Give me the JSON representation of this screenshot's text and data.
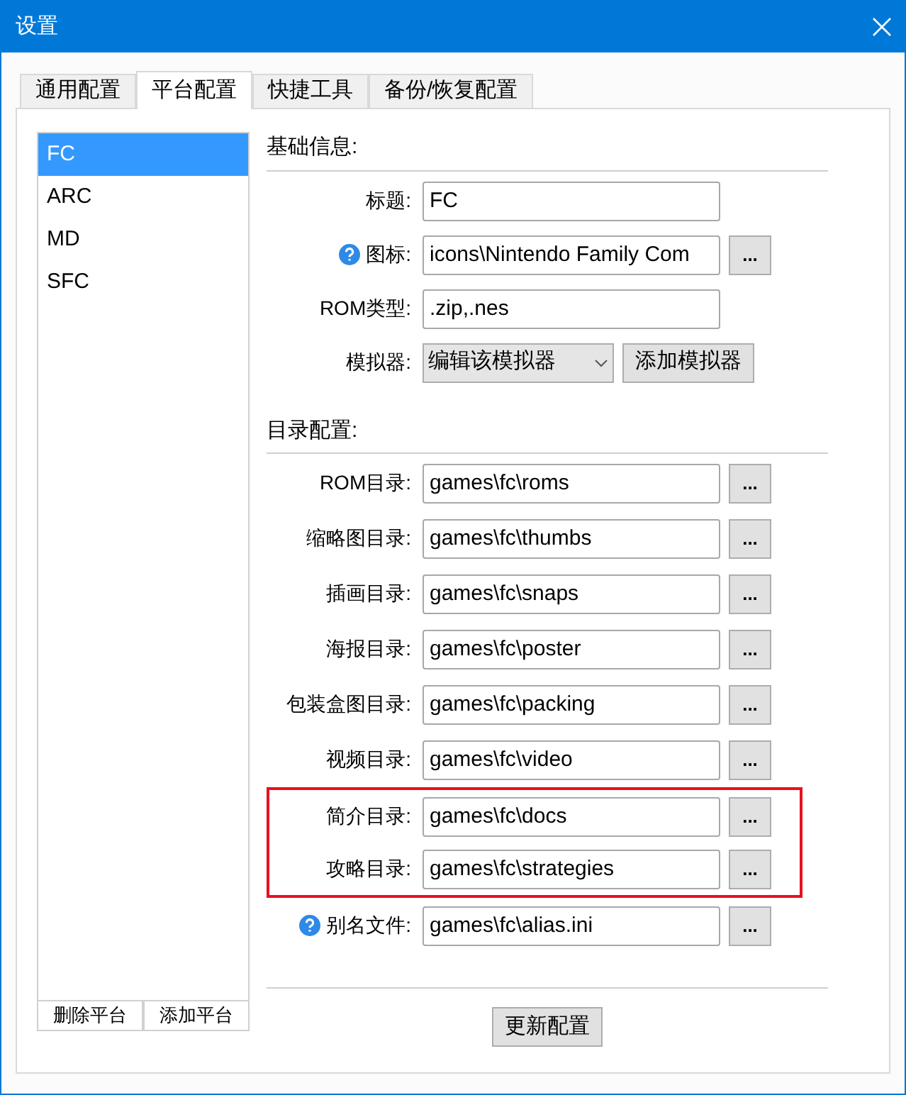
{
  "window": {
    "title": "设置"
  },
  "tabs": [
    {
      "label": "通用配置",
      "selected": false
    },
    {
      "label": "平台配置",
      "selected": true
    },
    {
      "label": "快捷工具",
      "selected": false
    },
    {
      "label": "备份/恢复配置",
      "selected": false
    }
  ],
  "platforms": {
    "items": [
      {
        "label": "FC",
        "selected": true
      },
      {
        "label": "ARC",
        "selected": false
      },
      {
        "label": "MD",
        "selected": false
      },
      {
        "label": "SFC",
        "selected": false
      }
    ],
    "buttons": [
      "删除平台",
      "添加平台"
    ]
  },
  "basic_info": {
    "heading": "基础信息:",
    "rows": [
      {
        "kind": "text",
        "label": "标题:",
        "value": "FC",
        "help": false
      },
      {
        "kind": "path",
        "label": "图标:",
        "value": "icons\\Nintendo Family Com",
        "button": "...",
        "help": true
      },
      {
        "kind": "text",
        "label": "ROM类型:",
        "value": ".zip,.nes",
        "help": false
      },
      {
        "kind": "select",
        "label": "模拟器:",
        "value": "编辑该模拟器",
        "button": "添加模拟器",
        "help": false
      }
    ]
  },
  "directories": {
    "heading": "目录配置:",
    "rows": [
      {
        "label": "ROM目录:",
        "value": "games\\fc\\roms",
        "button": "...",
        "help": false,
        "highlighted": false
      },
      {
        "label": "缩略图目录:",
        "value": "games\\fc\\thumbs",
        "button": "...",
        "help": false,
        "highlighted": false
      },
      {
        "label": "插画目录:",
        "value": "games\\fc\\snaps",
        "button": "...",
        "help": false,
        "highlighted": false
      },
      {
        "label": "海报目录:",
        "value": "games\\fc\\poster",
        "button": "...",
        "help": false,
        "highlighted": false
      },
      {
        "label": "包装盒图目录:",
        "value": "games\\fc\\packing",
        "button": "...",
        "help": false,
        "highlighted": false
      },
      {
        "label": "视频目录:",
        "value": "games\\fc\\video",
        "button": "...",
        "help": false,
        "highlighted": false
      },
      {
        "label": "简介目录:",
        "value": "games\\fc\\docs",
        "button": "...",
        "help": false,
        "highlighted": true
      },
      {
        "label": "攻略目录:",
        "value": "games\\fc\\strategies",
        "button": "...",
        "help": false,
        "highlighted": true
      },
      {
        "label": "别名文件:",
        "value": "games\\fc\\alias.ini",
        "button": "...",
        "help": true,
        "highlighted": false
      }
    ]
  },
  "update_button": "更新配置"
}
